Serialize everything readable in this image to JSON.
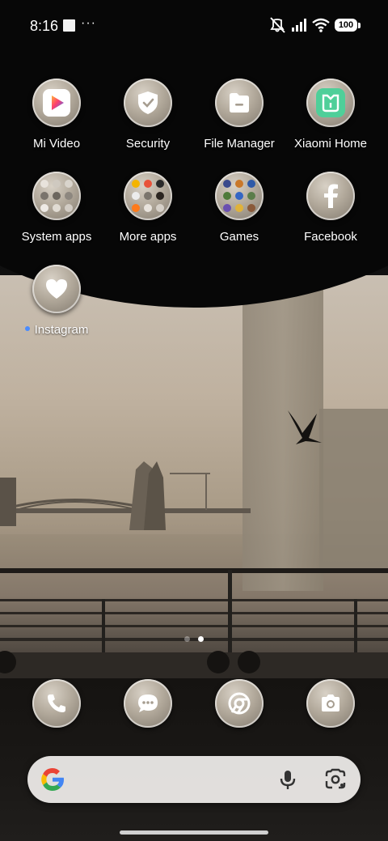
{
  "status_bar": {
    "time": "8:16",
    "overflow": "···",
    "battery": "100",
    "icons": [
      "notification-square-icon",
      "mute-vibrate-icon",
      "signal-icon",
      "wifi-icon",
      "battery-icon"
    ]
  },
  "apps": [
    {
      "label": "Mi Video",
      "icon": "play-icon"
    },
    {
      "label": "Security",
      "icon": "shield-icon"
    },
    {
      "label": "File Manager",
      "icon": "folder-icon"
    },
    {
      "label": "Xiaomi Home",
      "icon": "mi-home-icon"
    },
    {
      "label": "System apps",
      "icon": "folder-icon"
    },
    {
      "label": "More apps",
      "icon": "folder-icon"
    },
    {
      "label": "Games",
      "icon": "folder-icon"
    },
    {
      "label": "Facebook",
      "icon": "facebook-icon"
    },
    {
      "label": "Instagram",
      "icon": "heart-icon",
      "new": true
    }
  ],
  "dock": [
    {
      "name": "Phone",
      "icon": "phone-icon"
    },
    {
      "name": "Messages",
      "icon": "message-icon"
    },
    {
      "name": "Chrome",
      "icon": "chrome-icon"
    },
    {
      "name": "Camera",
      "icon": "camera-icon"
    }
  ],
  "pages": {
    "count": 2,
    "active": 2
  },
  "search_bar": {
    "icons": [
      "google-logo-icon",
      "microphone-icon",
      "google-lens-icon"
    ]
  },
  "colors": {
    "accent_dot": "#4a8cff",
    "icon_bg": "#b2a99b",
    "search_bg": "#f0eeec"
  }
}
